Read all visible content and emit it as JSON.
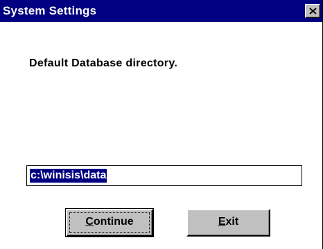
{
  "window": {
    "title": "System Settings",
    "close_icon": "close-x-icon"
  },
  "dialog": {
    "prompt": "Default Database directory.",
    "directory_value": "c:\\winisis\\data"
  },
  "buttons": {
    "continue_mnemonic": "C",
    "continue_rest": "ontinue",
    "exit_mnemonic": "E",
    "exit_rest": "xit"
  },
  "colors": {
    "titlebar": "#000080",
    "button_face": "#c0c0c0",
    "selection": "#000080"
  }
}
